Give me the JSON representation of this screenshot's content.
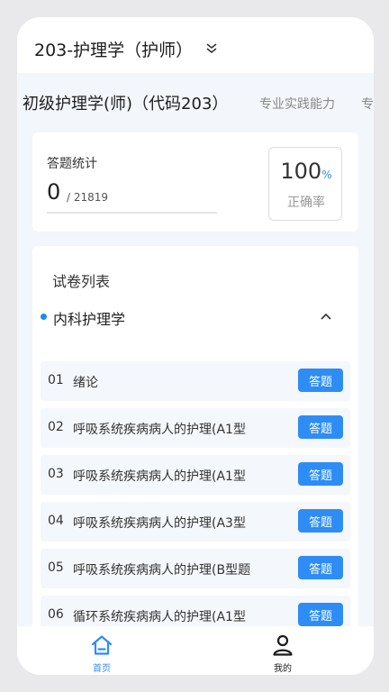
{
  "header": {
    "exam_title": "203-护理学（护师）"
  },
  "tabs": [
    {
      "label": "初级护理学(师)（代码203）",
      "active": true
    },
    {
      "label": "专业实践能力",
      "active": false
    },
    {
      "label": "专",
      "active": false
    }
  ],
  "stats": {
    "title": "答题统计",
    "answered": "0",
    "total": "/ 21819",
    "progress_fraction": 0,
    "rate_value": "100",
    "rate_unit": "%",
    "rate_label": "正确率"
  },
  "papers": {
    "title": "试卷列表",
    "section": {
      "title": "内科护理学",
      "items": [
        {
          "no": "01",
          "name": "绪论",
          "action": "答题"
        },
        {
          "no": "02",
          "name": "呼吸系统疾病病人的护理(A1型",
          "action": "答题"
        },
        {
          "no": "03",
          "name": "呼吸系统疾病病人的护理(A1型",
          "action": "答题"
        },
        {
          "no": "04",
          "name": "呼吸系统疾病病人的护理(A3型",
          "action": "答题"
        },
        {
          "no": "05",
          "name": "呼吸系统疾病病人的护理(B型题",
          "action": "答题"
        },
        {
          "no": "06",
          "name": "循环系统疾病病人的护理(A1型",
          "action": "答题"
        }
      ]
    }
  },
  "nav": {
    "home_label": "首页",
    "mine_label": "我的"
  },
  "colors": {
    "accent": "#2e8df4",
    "row_bg": "#f4f7fc",
    "page_bg": "#f3f6fb"
  },
  "icons": {
    "expand": "chevron-down-icon",
    "collapse": "chevron-up-icon",
    "home": "home-icon",
    "mine": "user-icon"
  }
}
